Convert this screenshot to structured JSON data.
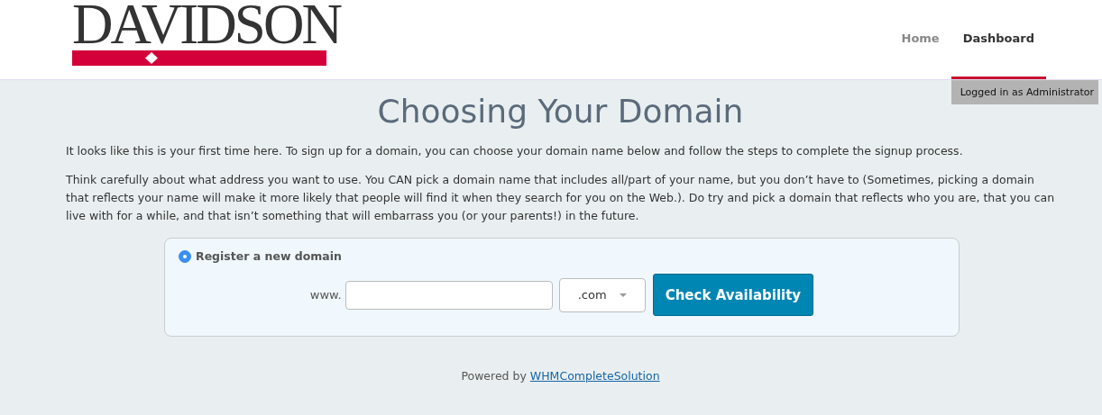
{
  "header": {
    "logo": "DAVIDSON",
    "nav": [
      {
        "label": "Home",
        "selected": false
      },
      {
        "label": "Dashboard",
        "selected": true
      }
    ],
    "login_badge": "Logged in as Administrator"
  },
  "title": "Choosing Your Domain",
  "paragraphs": [
    "It looks like this is your first time here. To sign up for a domain, you can choose your domain name below and follow the steps to complete the signup process.",
    "Think carefully about what address you want to use. You CAN pick a domain name that includes all/part of your name, but you don’t have to (Sometimes, picking a domain that reflects your name will make it more likely that people will find it when they search for you on the Web.). Do try and pick a domain that reflects who you are, that you can live with for a while, and that isn’t something that will embarrass you (or your parents!) in the future."
  ],
  "domain_form": {
    "option": {
      "label": "Register a new domain",
      "selected": true
    },
    "prefix": "www.",
    "tld": ".com",
    "button": "Check Availability"
  },
  "footer": {
    "text": "Powered by",
    "link": "WHMCompleteSolution"
  }
}
